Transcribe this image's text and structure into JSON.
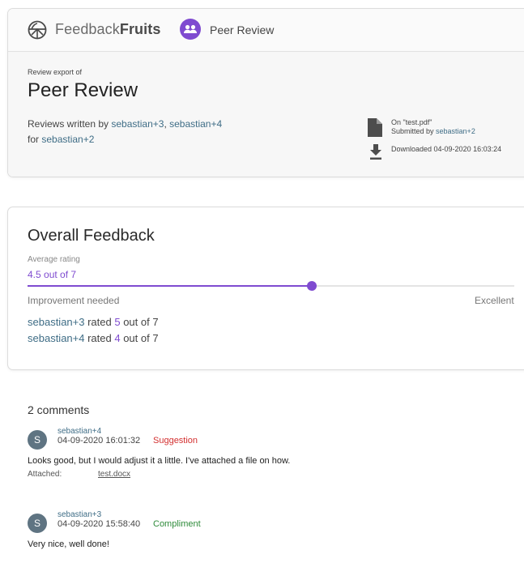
{
  "app": {
    "brand_light": "Feedback",
    "brand_bold": "Fruits",
    "tool_name": "Peer Review",
    "accent_color": "#7f4bd0",
    "link_color": "#3f6d86"
  },
  "header": {
    "export_label": "Review export of",
    "title": "Peer Review",
    "reviews_prefix": "Reviews written by ",
    "reviewers": [
      "sebastian+3",
      "sebastian+4"
    ],
    "reviewer_separator": ", ",
    "for_prefix": "for ",
    "reviewee": "sebastian+2",
    "file_on": "On \"test.pdf\"",
    "submitted_prefix": "Submitted by ",
    "submitted_by": "sebastian+2",
    "downloaded": "Downloaded 04-09-2020 16:03:24"
  },
  "overall": {
    "title": "Overall Feedback",
    "average_label": "Average rating",
    "average_text": "4.5 out of 7",
    "average_value": 4.5,
    "scale_max": 7,
    "low_label": "Improvement needed",
    "high_label": "Excellent",
    "ratings": [
      {
        "user": "sebastian+3",
        "rated": " rated ",
        "value": "5",
        "suffix": " out of 7"
      },
      {
        "user": "sebastian+4",
        "rated": " rated ",
        "value": "4",
        "suffix": " out of 7"
      }
    ]
  },
  "comments": {
    "count_label": "2 comments",
    "items": [
      {
        "avatar": "S",
        "author": "sebastian+4",
        "timestamp": "04-09-2020 16:01:32",
        "type": "Suggestion",
        "type_color": "#d32f2f",
        "text": "Looks good, but I would adjust it a little. I've attached a file on how.",
        "attached_label": "Attached:",
        "attached_file": "test.docx"
      },
      {
        "avatar": "S",
        "author": "sebastian+3",
        "timestamp": "04-09-2020 15:58:40",
        "type": "Compliment",
        "type_color": "#2e8b3a",
        "text": "Very nice, well done!"
      }
    ]
  }
}
